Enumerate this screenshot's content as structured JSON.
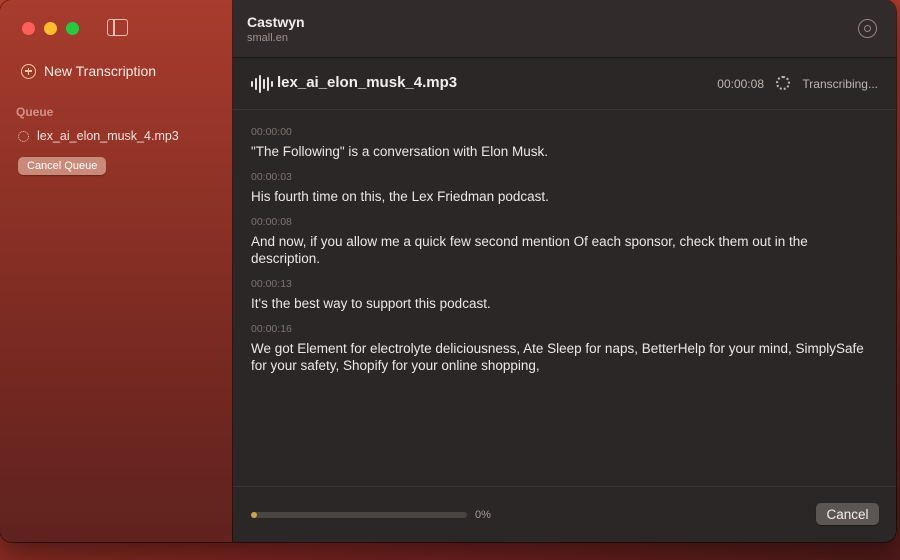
{
  "sidebar": {
    "window_controls": [
      "close",
      "minimize",
      "zoom"
    ],
    "toggle_icon": "sidebar-toggle-icon",
    "new_transcription": {
      "icon": "plus-circle-icon",
      "label": "New Transcription"
    },
    "queue": {
      "title": "Queue",
      "items": [
        {
          "icon": "spinner-icon",
          "label": "lex_ai_elon_musk_4.mp3"
        }
      ],
      "cancel_label": "Cancel Queue"
    }
  },
  "header": {
    "title": "Castwyn",
    "subtitle": "small.en",
    "settings_icon": "gear-icon"
  },
  "file": {
    "icon": "waveform-icon",
    "name": "lex_ai_elon_musk_4.mp3",
    "elapsed": "00:00:08",
    "status": "Transcribing..."
  },
  "segments": [
    {
      "time": "00:00:00",
      "text": "\"The Following\" is a conversation with Elon Musk."
    },
    {
      "time": "00:00:03",
      "text": "His fourth time on this, the Lex Friedman podcast."
    },
    {
      "time": "00:00:08",
      "text": "And now, if you allow me a quick few second mention Of each sponsor, check them out in the description."
    },
    {
      "time": "00:00:13",
      "text": "It's the best way to support this podcast."
    },
    {
      "time": "00:00:16",
      "text": "We got Element for electrolyte deliciousness, Ate Sleep for naps, BetterHelp for your mind, SimplySafe for your safety, Shopify for your online shopping,"
    }
  ],
  "footer": {
    "progress_percent": 0,
    "progress_label": "0%",
    "cancel_label": "Cancel"
  },
  "colors": {
    "accent": "#c9a54a",
    "sidebar": "#8f3226",
    "content_bg": "#2b2726"
  }
}
